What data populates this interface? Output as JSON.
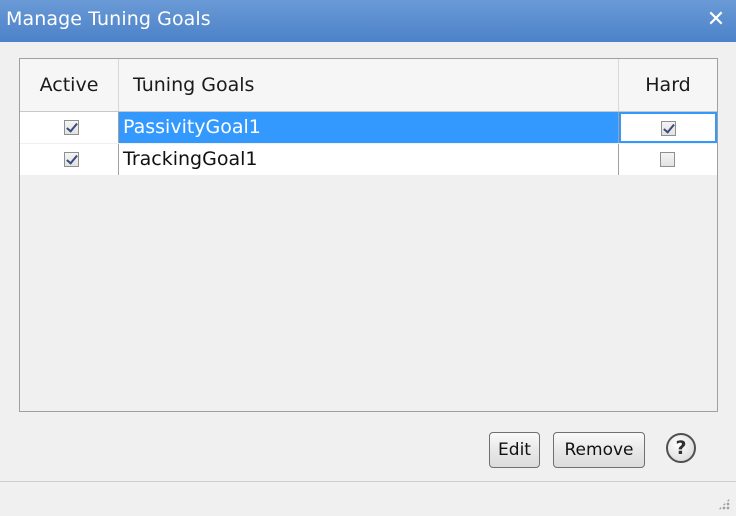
{
  "window": {
    "title": "Manage Tuning Goals",
    "close_glyph": "✕"
  },
  "table": {
    "headers": {
      "active": "Active",
      "goals": "Tuning Goals",
      "hard": "Hard"
    },
    "rows": [
      {
        "active": true,
        "name": "PassivityGoal1",
        "hard": true,
        "selected": true
      },
      {
        "active": true,
        "name": "TrackingGoal1",
        "hard": false,
        "selected": false
      }
    ]
  },
  "buttons": {
    "edit": "Edit",
    "remove": "Remove",
    "help": "?"
  },
  "colors": {
    "titlebar": "#4c82c9",
    "selection": "#3399ff"
  }
}
